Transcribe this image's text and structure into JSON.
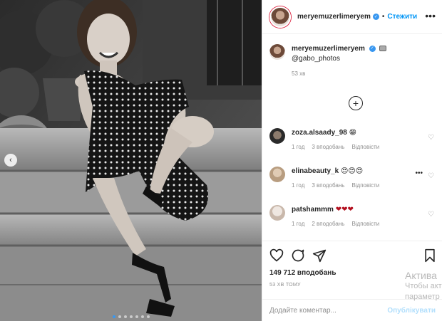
{
  "header": {
    "username": "meryemuzerlimeryem",
    "separator": "•",
    "follow_label": "Стежити",
    "more_label": "•••"
  },
  "caption": {
    "username": "meryemuzerlimeryem",
    "mention": "@gabo_photos",
    "time": "53 хв"
  },
  "load_more_label": "+",
  "comments": [
    {
      "user": "zoza.alsaady_98",
      "text": "😁",
      "time": "1 год",
      "likes": "3 вподобань",
      "reply": "Відповісти"
    },
    {
      "user": "elinabeauty_k",
      "text": "😍😍😍",
      "time": "1 год",
      "likes": "3 вподобань",
      "reply": "Відповісти",
      "more": "•••"
    },
    {
      "user": "patshammm",
      "text": "❤❤❤",
      "time": "1 год",
      "likes": "2 вподобань",
      "reply": "Відповісти"
    }
  ],
  "likes": "149 712 вподобань",
  "posted_ago": "53 ХВ ТОМУ",
  "add_comment": {
    "placeholder": "Додайте коментар...",
    "publish_label": "Опублікувати"
  },
  "watermark": {
    "line1": "Актива",
    "line2": "Чтобы акт",
    "line3": "параметр"
  },
  "carousel": {
    "prev_label": "‹",
    "count": 7,
    "active_index": 0
  },
  "colors": {
    "accent": "#0095f6",
    "verified": "#3897f0",
    "muted": "#8e8e8e",
    "heart_red": "#d0021b"
  }
}
